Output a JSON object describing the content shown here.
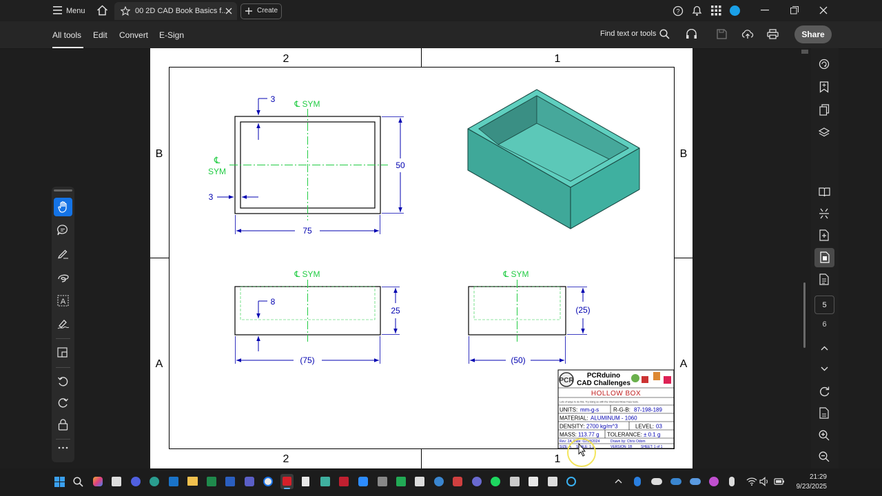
{
  "titlebar": {
    "menu_label": "Menu",
    "tab_title": "00 2D CAD Book Basics f...",
    "create_label": "Create"
  },
  "toolbar": {
    "menus": [
      "All tools",
      "Edit",
      "Convert",
      "E-Sign"
    ],
    "find_label": "Find text or tools",
    "share_label": "Share"
  },
  "rightrail": {
    "page_current": "5",
    "page_next": "6"
  },
  "drawing": {
    "zones_top": [
      "2",
      "1"
    ],
    "zones_bottom": [
      "2",
      "1"
    ],
    "zones_left": [
      "B",
      "A"
    ],
    "zones_right": [
      "B",
      "A"
    ],
    "sym_label": "℄ SYM",
    "sym_cl": "℄",
    "sym_word": "SYM",
    "dims": {
      "wall_top": "3",
      "wall_left": "3",
      "height": "50",
      "width": "75",
      "depth": "25",
      "floor": "8",
      "width_ref": "(75)",
      "depth_ref": "(25)",
      "length_ref": "(50)"
    },
    "colors": {
      "border": "#000000",
      "dimension": "#0000b0",
      "centerline": "#22cc44",
      "model_face": "#3fb0a0",
      "model_top": "#5fcfbf"
    }
  },
  "title_block": {
    "company": "PCRduino",
    "subtitle": "CAD Challenges",
    "part_name": "HOLLOW BOX",
    "note": "Lots of ways to do this. Try doing so with the Shell and Move Face tools.",
    "units_label": "UNITS:",
    "units_value": "mm-g-s",
    "rgb_label": "R-G-B:",
    "rgb_value": "87-198-189",
    "material_label": "MATERIAL:",
    "material_value": "ALUMINUM - 1060",
    "density_label": "DENSITY:",
    "density_value": "2700 kg/m^3",
    "level_label": "LEVEL:",
    "level_value": "03",
    "mass_label": "MASS:",
    "mass_value": "113.77 g",
    "tolerance_label": "TOLERANCE:",
    "tolerance_value": "± 0.1 g",
    "rev": "Rev: 2A",
    "date": "Date: 02/18/2024",
    "drawn_by": "Drawn by: Chris Odom",
    "size": "SIZE: A",
    "scale": "SCALE: 1:1",
    "version": "VERSION: 1B",
    "sheet": "SHEET: 1 of 1"
  },
  "tray": {
    "time": "21:29",
    "date": "9/23/2025"
  }
}
